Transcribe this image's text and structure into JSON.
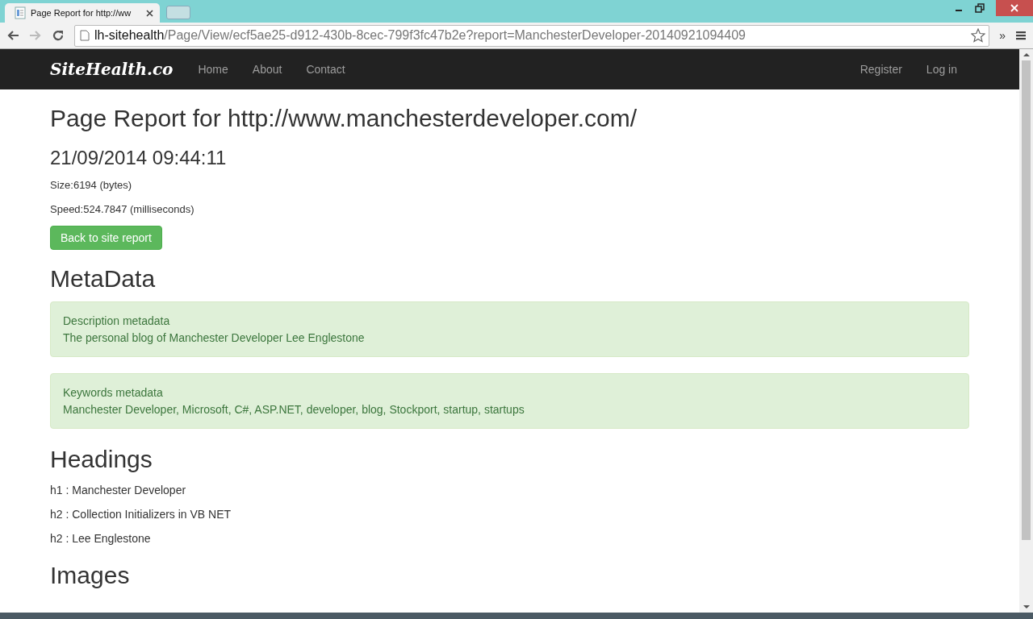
{
  "browser": {
    "tab_title": "Page Report for http://ww",
    "url_host": "lh-sitehealth",
    "url_rest": "/Page/View/ecf5ae25-d912-430b-8cec-799f3fc47b2e?report=ManchesterDeveloper-20140921094409",
    "overflow": "»"
  },
  "navbar": {
    "brand": "SiteHealth.co",
    "links": [
      {
        "label": "Home"
      },
      {
        "label": "About"
      },
      {
        "label": "Contact"
      }
    ],
    "right_links": [
      {
        "label": "Register"
      },
      {
        "label": "Log in"
      }
    ]
  },
  "report": {
    "title": "Page Report for http://www.manchesterdeveloper.com/",
    "date": "21/09/2014 09:44:11",
    "size": "Size:6194 (bytes)",
    "speed": "Speed:524.7847 (milliseconds)",
    "back_button": "Back to site report"
  },
  "metadata": {
    "heading": "MetaData",
    "panels": [
      {
        "label": "Description metadata",
        "value": "The personal blog of Manchester Developer Lee Englestone"
      },
      {
        "label": "Keywords metadata",
        "value": "Manchester Developer, Microsoft, C#, ASP.NET, developer, blog, Stockport, startup, startups"
      }
    ]
  },
  "headings": {
    "heading": "Headings",
    "items": [
      "h1 : Manchester Developer",
      "h2 : Collection Initializers in VB NET",
      "h2 : Lee Englestone"
    ]
  },
  "images": {
    "heading": "Images"
  }
}
